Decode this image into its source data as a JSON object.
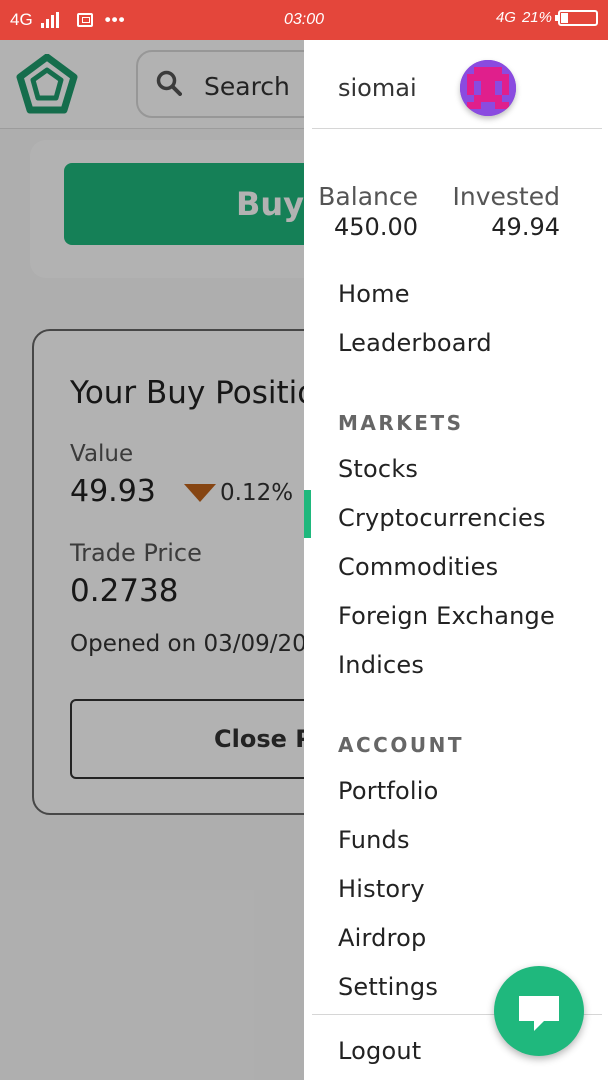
{
  "status_bar": {
    "network": "4G",
    "time": "03:00",
    "net_right": "4G",
    "battery": "21%"
  },
  "background": {
    "search_label": "Search",
    "buy_label": "Buy",
    "position": {
      "title": "Your Buy Position",
      "value_label": "Value",
      "value": "49.93",
      "change": "0.12%",
      "trade_price_label": "Trade Price",
      "trade_price": "0.2738",
      "opened": "Opened on 03/09/20",
      "close_label": "Close P"
    }
  },
  "drawer": {
    "username": "siomai",
    "balance_label": "Balance",
    "balance": "450.00",
    "invested_label": "Invested",
    "invested": "49.94",
    "main_items": [
      "Home",
      "Leaderboard"
    ],
    "markets_heading": "MARKETS",
    "markets_items": [
      "Stocks",
      "Cryptocurrencies",
      "Commodities",
      "Foreign Exchange",
      "Indices"
    ],
    "active_item": "Cryptocurrencies",
    "account_heading": "ACCOUNT",
    "account_items": [
      "Portfolio",
      "Funds",
      "History",
      "Airdrop",
      "Settings"
    ],
    "logout": "Logout"
  },
  "colors": {
    "accent": "#1fb87d",
    "status_bar": "#e4463b",
    "down": "#c0631b",
    "avatar": "#7a3fd6"
  }
}
